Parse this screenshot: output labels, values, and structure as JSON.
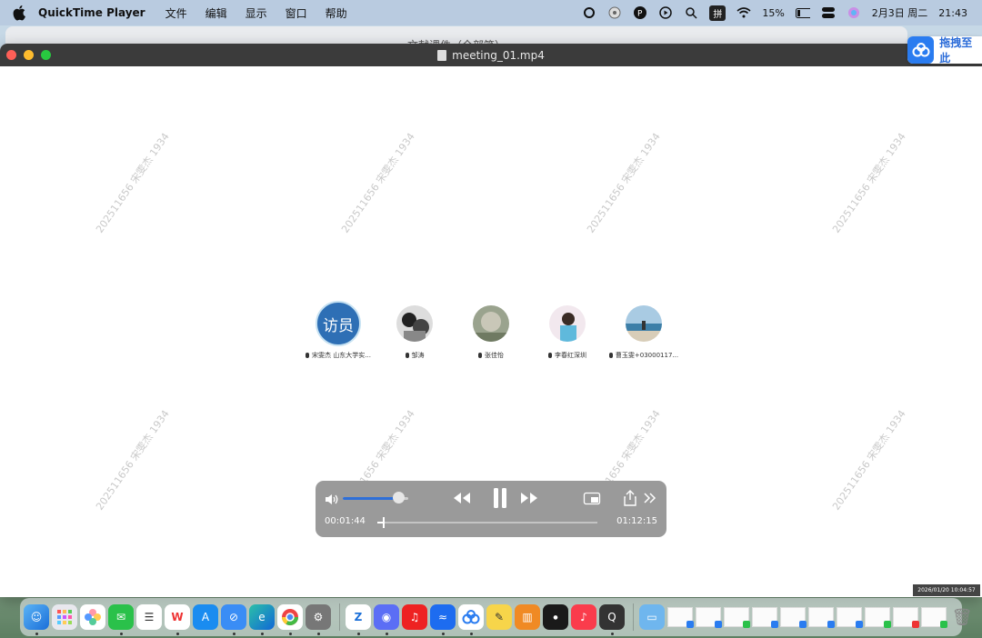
{
  "menubar": {
    "app_name": "QuickTime Player",
    "menus": [
      "文件",
      "编辑",
      "显示",
      "窗口",
      "帮助"
    ],
    "input_method": "拼",
    "battery": "15%",
    "date": "2月3日 周二",
    "time": "21:43"
  },
  "back_window": {
    "title": "文献课件（全部笔）"
  },
  "baidu_pill": {
    "label": "拖拽至此"
  },
  "window": {
    "title": "meeting_01.mp4"
  },
  "watermark": {
    "text": "202511656 宋雯杰 1934"
  },
  "participants": [
    {
      "avatar_text": "访员",
      "name": "宋雯杰 山东大学实..."
    },
    {
      "avatar_text": "",
      "name": "邹涛"
    },
    {
      "avatar_text": "",
      "name": "张佳怡"
    },
    {
      "avatar_text": "",
      "name": "李春红深圳"
    },
    {
      "avatar_text": "",
      "name": "曹玉雯+03000117..."
    }
  ],
  "player": {
    "current_time": "00:01:44",
    "total_time": "01:12:15",
    "volume": 0.85,
    "progress": 0.024
  },
  "timestamp": "2026/01/20 10:04:57",
  "colors": {
    "menubar": "#b9cbe0",
    "titlebar": "#3b3b3b",
    "controls": "#9a9a9a",
    "accent": "#2e6fd8"
  }
}
